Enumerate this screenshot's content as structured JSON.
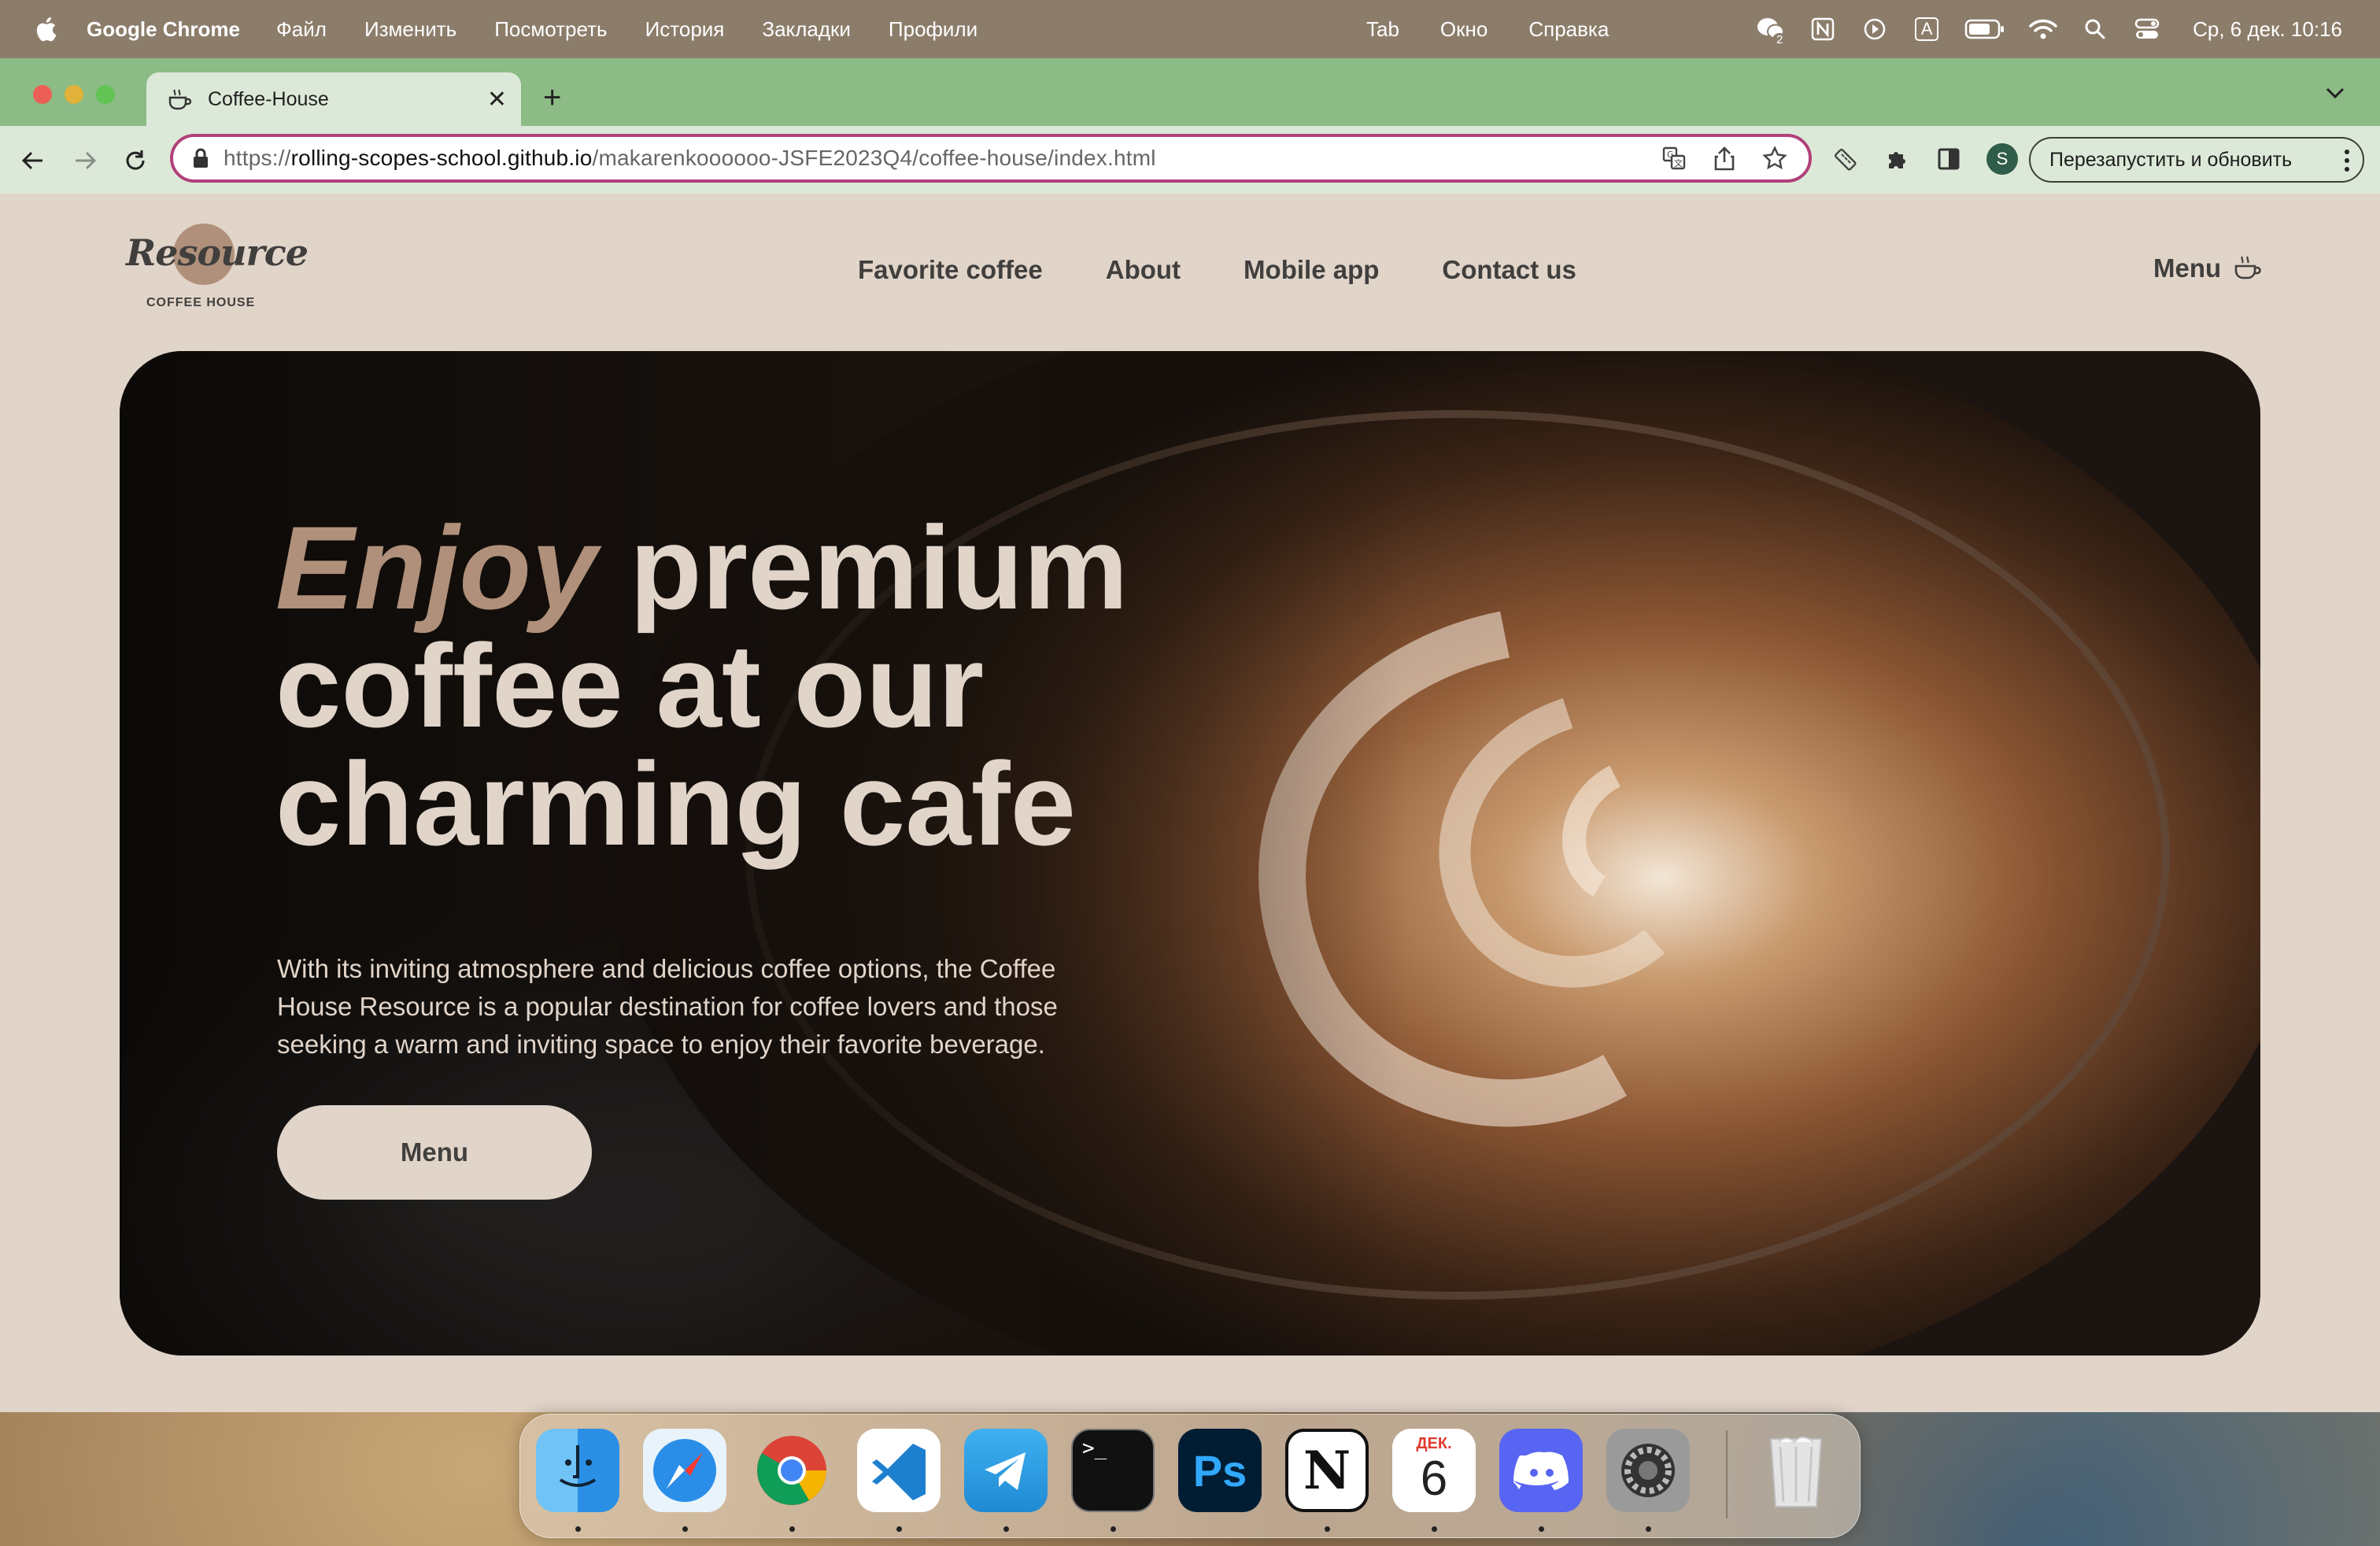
{
  "menubar": {
    "app_name": "Google Chrome",
    "items": [
      "Файл",
      "Изменить",
      "Посмотреть",
      "История",
      "Закладки",
      "Профили"
    ],
    "center_items": [
      "Tab",
      "Окно",
      "Справка"
    ],
    "clock": "Ср, 6 дек.  10:16",
    "tray": [
      "wechat-icon",
      "notion-tray-icon",
      "play-icon",
      "keyboard-layout-icon",
      "battery-icon",
      "wifi-icon",
      "spotlight-search-icon",
      "control-center-icon"
    ],
    "keyboard_layout": "A",
    "wechat_badge": "2"
  },
  "browser": {
    "tab_title": "Coffee-House",
    "url_scheme": "https://",
    "url_host": "rolling-scopes-school.github.io",
    "url_path": "/makarenkoooooo-JSFE2023Q4/coffee-house/index.html",
    "avatar_letter": "S",
    "relaunch_label": "Перезапустить и обновить",
    "colors": {
      "tabstrip": "#8cbb85",
      "toolbar": "#dde9d8",
      "omnibox_border": "#b0407a"
    }
  },
  "site": {
    "logo_word": "Resource",
    "logo_sub": "COFFEE HOUSE",
    "nav": [
      "Favorite coffee",
      "About",
      "Mobile app",
      "Contact us"
    ],
    "menu_label": "Menu",
    "hero": {
      "title_accent": "Enjoy",
      "title_line1_rest": " premium",
      "title_line2": "coffee at our",
      "title_line3": "charming cafe",
      "text": "With its inviting atmosphere and delicious coffee options, the Coffee House Resource is a popular destination for coffee lovers and those seeking a warm and inviting space to enjoy their favorite beverage.",
      "button": "Menu"
    },
    "colors": {
      "background": "#e1d4c9",
      "text_dark": "#403f3d",
      "accent": "#b0907a"
    }
  },
  "dock": {
    "apps": [
      "Finder",
      "Safari",
      "Google Chrome",
      "Visual Studio Code",
      "Telegram",
      "Terminal",
      "Photoshop",
      "Notion",
      "Calendar",
      "Discord",
      "System Settings",
      "Trash"
    ],
    "calendar_month": "ДЕК.",
    "calendar_day": "6"
  }
}
